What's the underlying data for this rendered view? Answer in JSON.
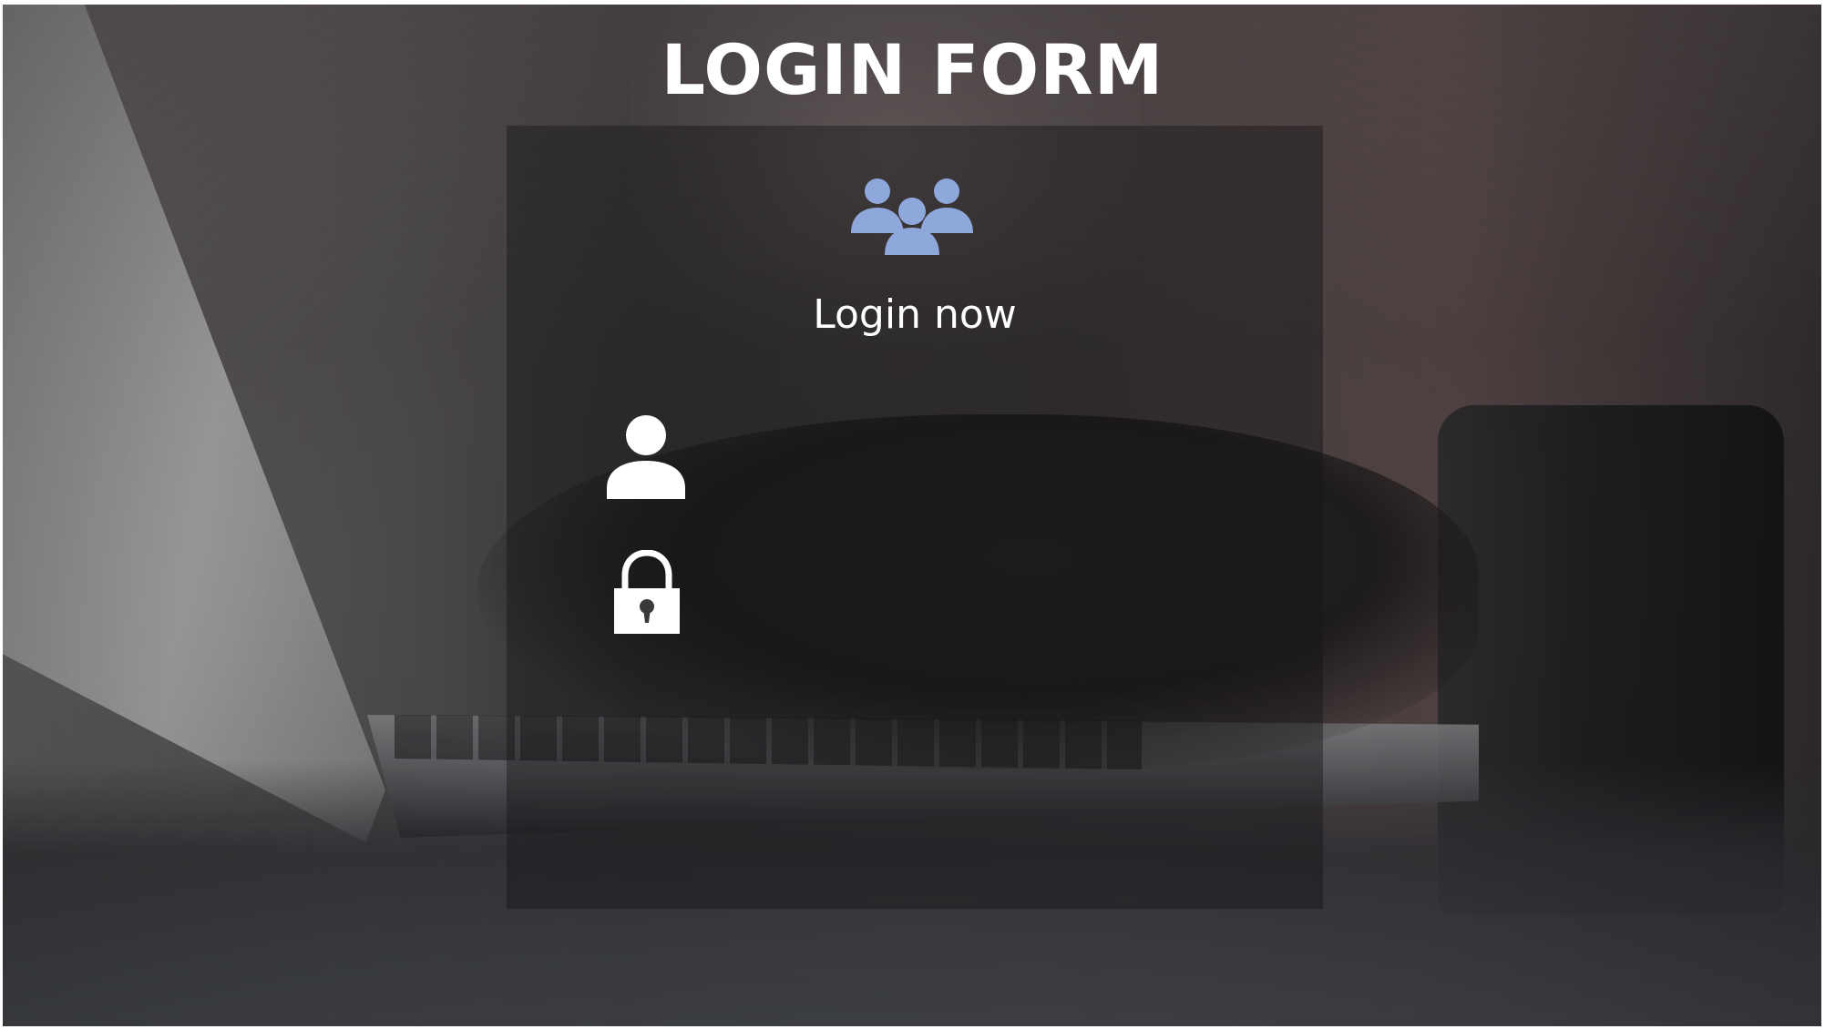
{
  "page": {
    "title": "LOGIN FORM"
  },
  "login_panel": {
    "heading": "Login now",
    "group_icon": "users-group-icon",
    "username_field": {
      "icon": "user-icon",
      "value": "",
      "placeholder": ""
    },
    "password_field": {
      "icon": "lock-icon",
      "value": "",
      "placeholder": ""
    }
  },
  "colors": {
    "accent": "#8fa8dc",
    "text": "#ffffff",
    "panel": "rgba(20,20,22,0.42)"
  }
}
